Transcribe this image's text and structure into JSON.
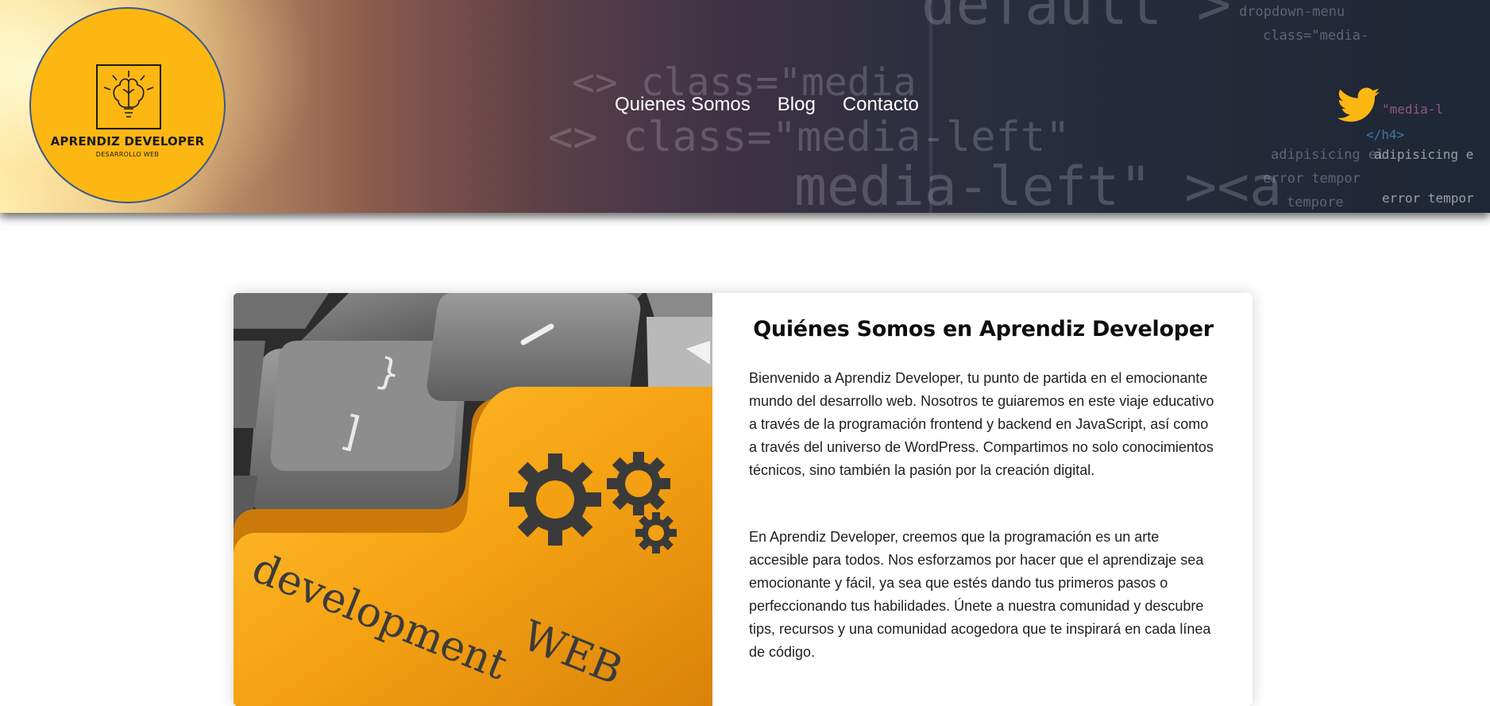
{
  "header": {
    "logo": {
      "name": "APRENDIZ DEVELOPER",
      "tagline": "DESARROLLO WEB"
    },
    "nav": [
      {
        "label": "Quienes Somos"
      },
      {
        "label": "Blog"
      },
      {
        "label": "Contacto"
      }
    ],
    "social_icon": "twitter-icon",
    "brand_color": "#fdb713"
  },
  "about": {
    "title": "Quiénes Somos en Aprendiz Developer",
    "paragraph_1": "Bienvenido a Aprendiz Developer, tu punto de partida en el emocionante mundo del desarrollo web. Nosotros te guiaremos en este viaje educativo a través de la programación frontend y backend en JavaScript, así como a través del universo de WordPress. Compartimos no solo conocimientos técnicos, sino también la pasión por la creación digital.",
    "paragraph_2": "En Aprendiz Developer, creemos que la programación es un arte accesible para todos. Nos esforzamos por hacer que el aprendizaje sea emocionante y fácil, ya sea que estés dando tus primeros pasos o perfeccionando tus habilidades. Únete a nuestra comunidad y descubre tips, recursos y una comunidad acogedora que te inspirará en cada línea de código.",
    "image": {
      "key_label": "WEB development",
      "icon": "gears-icon"
    }
  }
}
